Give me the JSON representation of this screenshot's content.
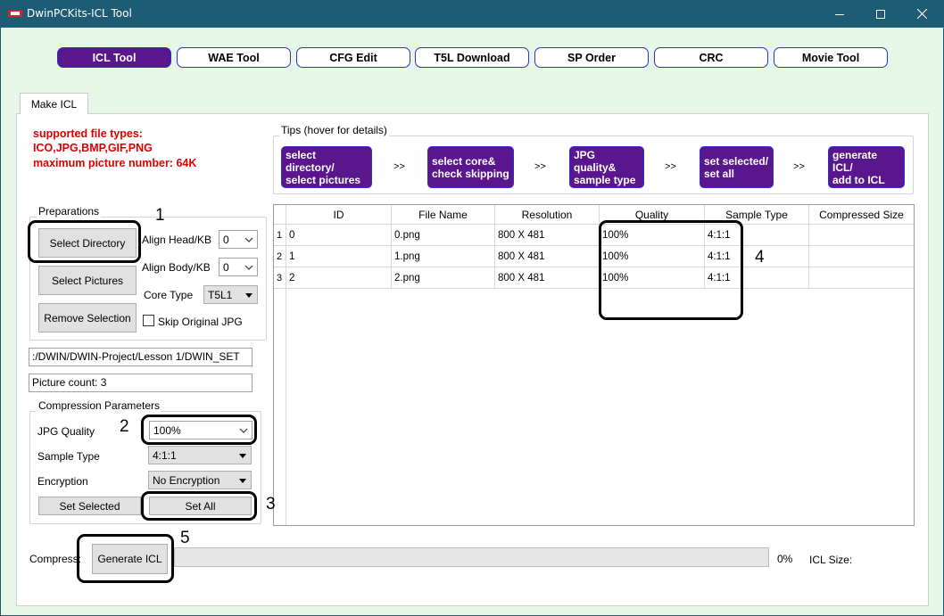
{
  "window": {
    "title": "DwinPCKits-ICL Tool",
    "icons": {
      "app": "dwin-logo-icon",
      "minimize": "minimize-icon",
      "maximize": "maximize-icon",
      "close": "close-icon"
    }
  },
  "nav": {
    "buttons": [
      {
        "label": "ICL Tool",
        "active": true
      },
      {
        "label": "WAE Tool",
        "active": false
      },
      {
        "label": "CFG Edit",
        "active": false
      },
      {
        "label": "T5L Download",
        "active": false
      },
      {
        "label": "SP Order",
        "active": false
      },
      {
        "label": "CRC",
        "active": false
      },
      {
        "label": "Movie Tool",
        "active": false
      }
    ]
  },
  "tab": {
    "label": "Make ICL"
  },
  "notes": {
    "line1": "supported file types:",
    "line2": "ICO,JPG,BMP,GIF,PNG",
    "line3": "maximum picture number: 64K"
  },
  "preparations": {
    "title": "Preparations",
    "select_directory": "Select Directory",
    "select_pictures": "Select Pictures",
    "remove_selection": "Remove Selection",
    "align_head_label": "Align Head/KB",
    "align_head_value": "0",
    "align_body_label": "Align Body/KB",
    "align_body_value": "0",
    "core_type_label": "Core Type",
    "core_type_value": "T5L1",
    "skip_jpg_label": "Skip Original JPG",
    "skip_jpg_checked": false
  },
  "path_field": ":/DWIN/DWIN-Project/Lesson 1/DWIN_SET",
  "picture_count": "Picture count: 3",
  "compression": {
    "title": "Compression Parameters",
    "jpg_quality_label": "JPG Quality",
    "jpg_quality_value": "100%",
    "sample_type_label": "Sample Type",
    "sample_type_value": "4:1:1",
    "encryption_label": "Encryption",
    "encryption_value": "No Encryption",
    "set_selected": "Set Selected",
    "set_all": "Set All"
  },
  "tips": {
    "title": "Tips (hover for details)",
    "items": [
      {
        "line1": "select directory/",
        "line2": "select pictures"
      },
      {
        "line1": "select core&",
        "line2": "check skipping"
      },
      {
        "line1": "JPG quality&",
        "line2": "sample type"
      },
      {
        "line1": "set selected/",
        "line2": "set all"
      },
      {
        "line1": "generate ICL/",
        "line2": "add to ICL"
      }
    ],
    "separator": ">>"
  },
  "table": {
    "columns": [
      "ID",
      "File Name",
      "Resolution",
      "Quality",
      "Sample Type",
      "Compressed Size"
    ],
    "rows": [
      {
        "num": "1",
        "id": "0",
        "file": "0.png",
        "res": "800 X 481",
        "quality": "100%",
        "sample": "4:1:1",
        "size": ""
      },
      {
        "num": "2",
        "id": "1",
        "file": "1.png",
        "res": "800 X 481",
        "quality": "100%",
        "sample": "4:1:1",
        "size": ""
      },
      {
        "num": "3",
        "id": "2",
        "file": "2.png",
        "res": "800 X 481",
        "quality": "100%",
        "sample": "4:1:1",
        "size": ""
      }
    ]
  },
  "bottom": {
    "compress_label": "Compress:",
    "generate_icl": "Generate ICL",
    "progress_fraction": 0,
    "progress_text": "0%",
    "icl_size_label": "ICL Size:"
  },
  "annotations": [
    "1",
    "2",
    "3",
    "4",
    "5"
  ]
}
